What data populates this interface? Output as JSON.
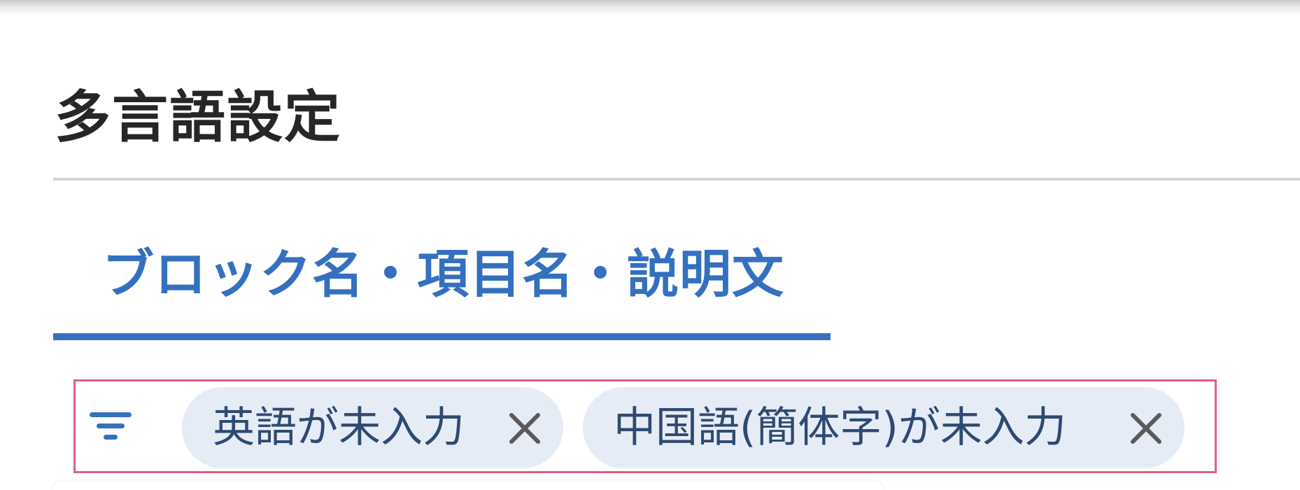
{
  "page": {
    "title": "多言語設定"
  },
  "tabs": [
    {
      "label": "ブロック名・項目名・説明文",
      "active": true
    }
  ],
  "filters": {
    "icon": "filter-icon",
    "chips": [
      {
        "label": "英語が未入力",
        "remove_icon": "close-icon"
      },
      {
        "label": "中国語(簡体字)が未入力",
        "remove_icon": "close-icon"
      }
    ]
  },
  "colors": {
    "accent": "#3470bf",
    "chip_background": "#e6ecf5",
    "chip_text": "#2f4a70",
    "highlight_border": "#e0607e",
    "title_text": "#262626"
  }
}
